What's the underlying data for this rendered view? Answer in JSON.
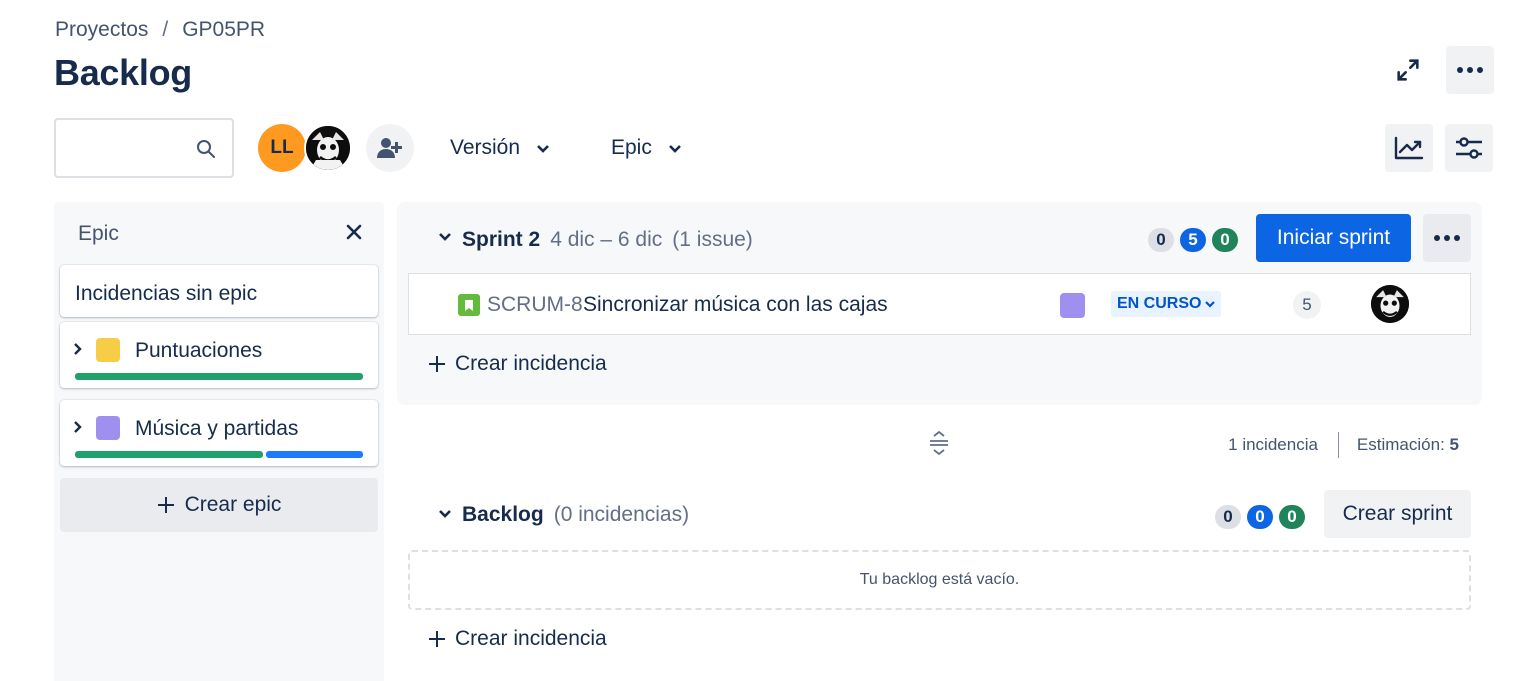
{
  "breadcrumb": {
    "items": [
      "Proyectos",
      "GP05PR"
    ],
    "separator": "/"
  },
  "page": {
    "title": "Backlog"
  },
  "header_actions": {
    "expand_icon": "expand-icon",
    "more_icon": "more-icon"
  },
  "toolbar": {
    "search": {
      "value": "",
      "placeholder": ""
    },
    "avatars": [
      {
        "initials": "LL",
        "color": "#ff991f"
      },
      {
        "initials": "",
        "image": "clown-avatar"
      }
    ],
    "filters": [
      {
        "label": "Versión"
      },
      {
        "label": "Epic"
      }
    ],
    "right_icons": [
      "insights-icon",
      "view-settings-icon"
    ]
  },
  "epic_panel": {
    "title": "Epic",
    "no_epic_label": "Incidencias sin epic",
    "epics": [
      {
        "name": "Puntuaciones",
        "color": "#f5cd47",
        "progress": {
          "done": 1.0,
          "in_progress": 0.0
        }
      },
      {
        "name": "Música y partidas",
        "color": "#9f8fef",
        "progress": {
          "done": 0.66,
          "in_progress": 0.34
        }
      }
    ],
    "create_label": "Crear epic"
  },
  "sprint": {
    "name": "Sprint 2",
    "dates": "4 dic – 6 dic",
    "issue_count": "(1 issue)",
    "counts": {
      "todo": "0",
      "in_progress": "5",
      "done": "0"
    },
    "start_label": "Iniciar sprint",
    "issues": [
      {
        "key": "SCRUM-8",
        "summary": "Sincronizar música con las cajas",
        "epic_color": "#9f8fef",
        "status": "EN CURSO",
        "estimate": "5"
      }
    ],
    "create_issue_label": "Crear incidencia"
  },
  "sprint_summary": {
    "issues_text": "1 incidencia",
    "estimate_label": "Estimación:",
    "estimate_value": "5"
  },
  "backlog": {
    "name": "Backlog",
    "issue_count": "(0 incidencias)",
    "counts": {
      "todo": "0",
      "in_progress": "0",
      "done": "0"
    },
    "create_sprint_label": "Crear sprint",
    "empty_text": "Tu backlog está vacío.",
    "create_issue_label": "Crear incidencia"
  },
  "colors": {
    "primary": "#0c66e4",
    "done": "#1f845a",
    "in_progress_bar": "#1d7afc",
    "done_bar": "#22a06b"
  }
}
